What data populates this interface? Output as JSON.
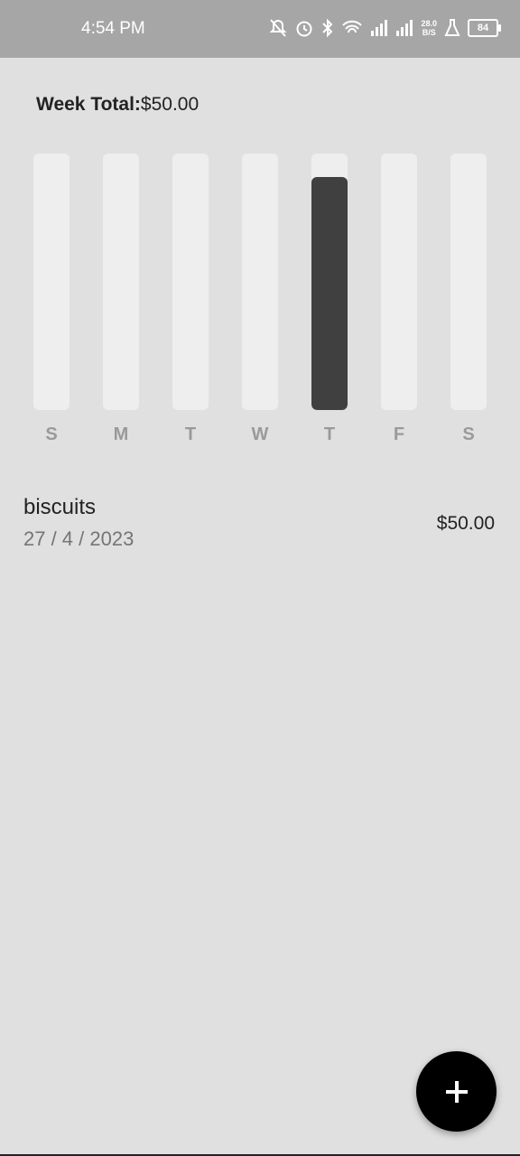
{
  "status_bar": {
    "time": "4:54 PM",
    "net_speed_value": "28.0",
    "net_speed_unit": "B/S",
    "battery": "84",
    "icons": [
      "bell-off-icon",
      "alarm-icon",
      "bluetooth-icon",
      "wifi-icon",
      "signal-icon",
      "signal-icon",
      "flask-icon",
      "battery-icon"
    ]
  },
  "summary": {
    "label": "Week Total:",
    "value": "$50.00"
  },
  "chart_data": {
    "type": "bar",
    "categories": [
      "S",
      "M",
      "T",
      "W",
      "T",
      "F",
      "S"
    ],
    "values": [
      0,
      0,
      0,
      0,
      50,
      0,
      0
    ],
    "ylim": [
      0,
      55
    ],
    "colors": {
      "track": "#eeeeee",
      "fill": "#404040"
    }
  },
  "transactions": [
    {
      "title": "biscuits",
      "date": "27 / 4 / 2023",
      "amount": "$50.00"
    }
  ],
  "fab": {
    "icon": "plus-icon"
  }
}
